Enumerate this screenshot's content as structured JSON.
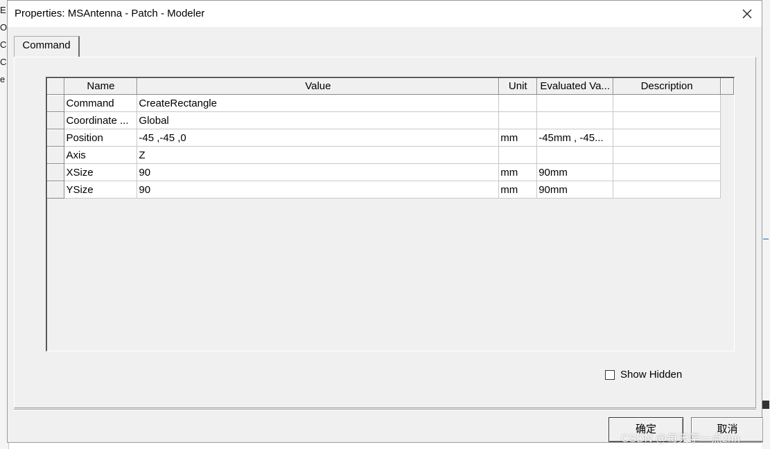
{
  "background_app": {
    "left_letters": [
      "E",
      "O",
      "C",
      "C",
      "e"
    ]
  },
  "dialog": {
    "title": "Properties: MSAntenna - Patch - Modeler",
    "close_glyph": "✕"
  },
  "tabs": [
    {
      "label": "Command",
      "active": true
    }
  ],
  "grid": {
    "columns": [
      "Name",
      "Value",
      "Unit",
      "Evaluated Va...",
      "Description"
    ],
    "rows": [
      {
        "name": "Command",
        "value": "CreateRectangle",
        "unit": "",
        "evaluated": "",
        "description": ""
      },
      {
        "name": "Coordinate ...",
        "value": "Global",
        "unit": "",
        "evaluated": "",
        "description": ""
      },
      {
        "name": "Position",
        "value": "-45 ,-45 ,0",
        "unit": "mm",
        "evaluated": "-45mm , -45...",
        "description": ""
      },
      {
        "name": "Axis",
        "value": "Z",
        "unit": "",
        "evaluated": "",
        "description": ""
      },
      {
        "name": "XSize",
        "value": "90",
        "unit": "mm",
        "evaluated": "90mm",
        "description": ""
      },
      {
        "name": "YSize",
        "value": "90",
        "unit": "mm",
        "evaluated": "90mm",
        "description": ""
      }
    ]
  },
  "show_hidden": {
    "label": "Show Hidden",
    "checked": false
  },
  "buttons": {
    "ok": "确定",
    "cancel": "取消"
  },
  "watermark": "CSDN @每天学一点zhn"
}
